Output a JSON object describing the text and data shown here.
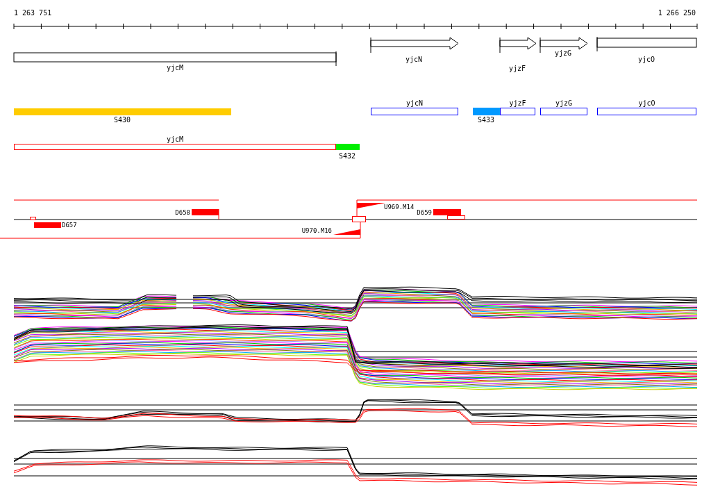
{
  "ruler": {
    "start": "1 263 751",
    "end": "1 266 250"
  },
  "genes": [
    {
      "name": "yjcM",
      "kind": "box"
    },
    {
      "name": "yjcN",
      "kind": "arrow"
    },
    {
      "name": "yjzF",
      "kind": "arrow"
    },
    {
      "name": "yjzG",
      "kind": "arrow"
    },
    {
      "name": "yjcO",
      "kind": "box"
    }
  ],
  "segments": [
    {
      "label": "S430",
      "color": "#ffcc00"
    },
    {
      "label": "S433",
      "color": "#0099ff"
    },
    {
      "label": "S432",
      "color": "#00ee00"
    }
  ],
  "transcripts": [
    {
      "name": "yjcN",
      "color": "#0000ff"
    },
    {
      "name": "yjzF",
      "color": "#0000ff"
    },
    {
      "name": "yjzG",
      "color": "#0000ff"
    },
    {
      "name": "yjcO",
      "color": "#0000ff"
    },
    {
      "name": "yjcM",
      "color": "#ff0000"
    }
  ],
  "promoters": [
    {
      "label": "D658",
      "kind": "block"
    },
    {
      "label": "D657",
      "kind": "block"
    },
    {
      "label": "U969.M14",
      "kind": "ramp"
    },
    {
      "label": "D659",
      "kind": "block"
    },
    {
      "label": "U970.M16",
      "kind": "ramp"
    }
  ]
}
